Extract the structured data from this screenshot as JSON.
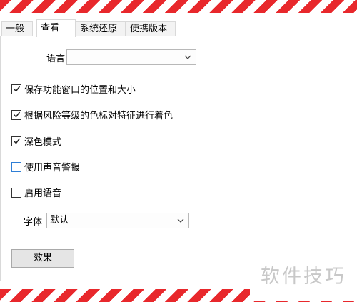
{
  "tabs": [
    {
      "label": "一般",
      "active": false
    },
    {
      "label": "查看",
      "active": true
    },
    {
      "label": "系统还原",
      "active": false
    },
    {
      "label": "便携版本",
      "active": false
    }
  ],
  "language": {
    "label": "语言",
    "value": ""
  },
  "options": [
    {
      "label": "保存功能窗口的位置和大小",
      "checked": true
    },
    {
      "label": "根据风险等级的色标对特征进行着色",
      "checked": true
    },
    {
      "label": "深色模式",
      "checked": true
    },
    {
      "label": "使用声音警报",
      "checked": false,
      "focused": true
    },
    {
      "label": "启用语音",
      "checked": false
    }
  ],
  "font": {
    "label": "字体",
    "value": "默认"
  },
  "effects_button": {
    "label": "效果"
  },
  "watermark": {
    "text": "软件技巧"
  },
  "colors": {
    "stripe_red": "#e8282c",
    "focus_blue": "#2f7fd6"
  }
}
